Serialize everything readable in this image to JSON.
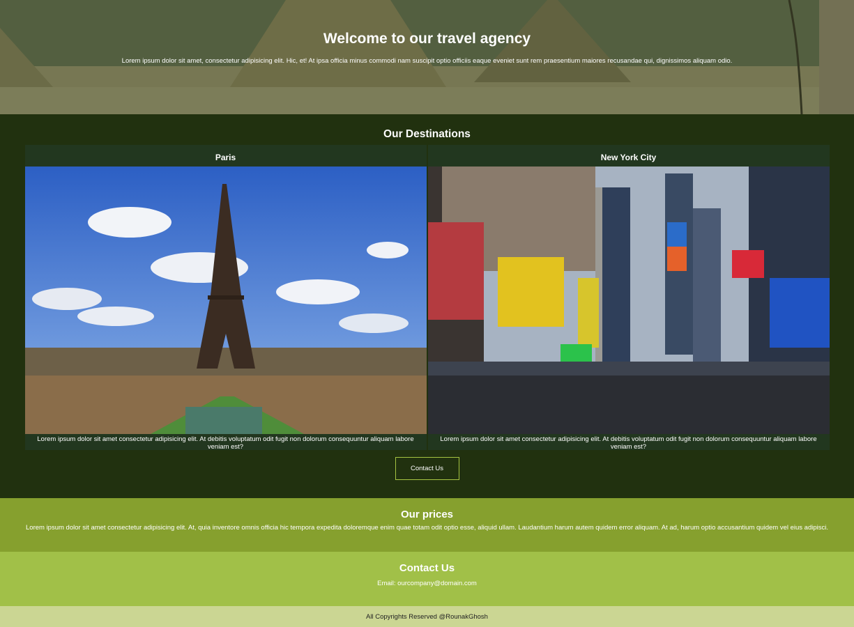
{
  "hero": {
    "title": "Welcome to our travel agency",
    "text": "Lorem ipsum dolor sit amet, consectetur adipisicing elit. Hic, et! At ipsa officia minus commodi nam suscipit optio officiis eaque eveniet sunt rem praesentium maiores recusandae qui, dignissimos aliquam odio."
  },
  "destinations": {
    "heading": "Our Destinations",
    "items": [
      {
        "name": "Paris",
        "description": "Lorem ipsum dolor sit amet consectetur adipisicing elit. At debitis voluptatum odit fugit non dolorum consequuntur aliquam labore veniam est?"
      },
      {
        "name": "New York City",
        "description": "Lorem ipsum dolor sit amet consectetur adipisicing elit. At debitis voluptatum odit fugit non dolorum consequuntur aliquam labore veniam est?"
      }
    ],
    "button_label": "Contact Us"
  },
  "prices": {
    "heading": "Our prices",
    "text": "Lorem ipsum dolor sit amet consectetur adipisicing elit. At, quia inventore omnis officia hic tempora expedita doloremque enim quae totam odit optio esse, aliquid ullam. Laudantium harum autem quidem error aliquam. At ad, harum optio accusantium quidem vel eius adipisci."
  },
  "contact": {
    "heading": "Contact Us",
    "email": "Email: ourcompany@domain.com"
  },
  "footer": {
    "text": "All Copyrights Reserved @RounakGhosh"
  },
  "colors": {
    "destinations_bg": "#21310f",
    "prices_bg": "#86a02e",
    "contact_bg": "#a1c048",
    "footer_bg": "#cbd693",
    "button_border": "#a6c442"
  }
}
